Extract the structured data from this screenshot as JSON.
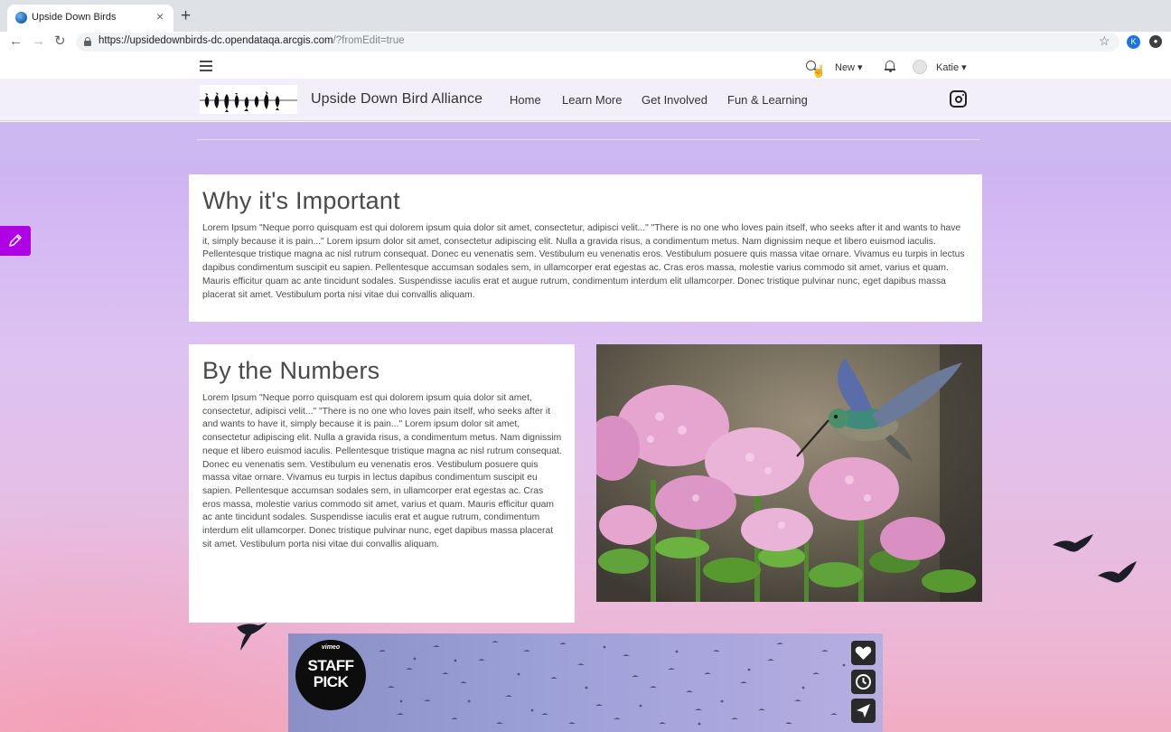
{
  "browser": {
    "tab_title": "Upside Down Birds",
    "tab_close": "×",
    "new_tab": "+",
    "url_host": "https://upsidedownbirds-dc.opendataqa.arcgis.com",
    "url_path": "/?fromEdit=true",
    "back": "←",
    "forward": "→",
    "reload": "↻",
    "star": "☆",
    "profile_initial": "K"
  },
  "arcgis": {
    "new_label": "New ▾",
    "user_label": "Katie ▾"
  },
  "site": {
    "title": "Upside Down Bird Alliance",
    "nav": [
      "Home",
      "Learn More",
      "Get Involved",
      "Fun & Learning"
    ]
  },
  "sections": {
    "why": {
      "title": "Why it's Important",
      "body": "Lorem Ipsum \"Neque porro quisquam est qui dolorem ipsum quia dolor sit amet, consectetur, adipisci velit...\" \"There is no one who loves pain itself, who seeks after it and wants to have it, simply because it is pain...\" Lorem ipsum dolor sit amet, consectetur adipiscing elit. Nulla a gravida risus, a condimentum metus. Nam dignissim neque et libero euismod iaculis. Pellentesque tristique magna ac nisl rutrum consequat. Donec eu venenatis sem. Vestibulum eu venenatis eros. Vestibulum posuere quis massa vitae ornare. Vivamus eu turpis in lectus dapibus condimentum suscipit eu sapien. Pellentesque accumsan sodales sem, in ullamcorper erat egestas ac. Cras eros massa, molestie varius commodo sit amet, varius et quam. Mauris efficitur quam ac ante tincidunt sodales. Suspendisse iaculis erat et augue rutrum, condimentum interdum elit ullamcorper. Donec tristique pulvinar nunc, eget dapibus massa placerat sit amet. Vestibulum porta nisi vitae dui convallis aliquam."
    },
    "numbers": {
      "title": "By the Numbers",
      "body": "Lorem Ipsum \"Neque porro quisquam est qui dolorem ipsum quia dolor sit amet, consectetur, adipisci velit...\" \"There is no one who loves pain itself, who seeks after it and wants to have it, simply because it is pain...\" Lorem ipsum dolor sit amet, consectetur adipiscing elit. Nulla a gravida risus, a condimentum metus. Nam dignissim neque et libero euismod iaculis. Pellentesque tristique magna ac nisl rutrum consequat. Donec eu venenatis sem. Vestibulum eu venenatis eros. Vestibulum posuere quis massa vitae ornare. Vivamus eu turpis in lectus dapibus condimentum suscipit eu sapien. Pellentesque accumsan sodales sem, in ullamcorper erat egestas ac. Cras eros massa, molestie varius commodo sit amet, varius et quam. Mauris efficitur quam ac ante tincidunt sodales. Suspendisse iaculis erat et augue rutrum, condimentum interdum elit ullamcorper. Donec tristique pulvinar nunc, eget dapibus massa placerat sit amet. Vestibulum porta nisi vitae dui convallis aliquam."
    }
  },
  "video": {
    "badge_brand": "vimeo",
    "badge_line1": "STAFF",
    "badge_line2": "PICK"
  },
  "colors": {
    "edit_accent": "#b000e6",
    "header_bg": "#f3effa",
    "page_gradient_top": "#c8b2f0",
    "page_gradient_bottom": "#f0adc2"
  },
  "icons": [
    "hamburger-icon",
    "search-icon",
    "bell-icon",
    "instagram-icon",
    "pencil-icon",
    "heart-icon",
    "clock-icon",
    "send-icon",
    "lock-icon",
    "star-icon"
  ]
}
